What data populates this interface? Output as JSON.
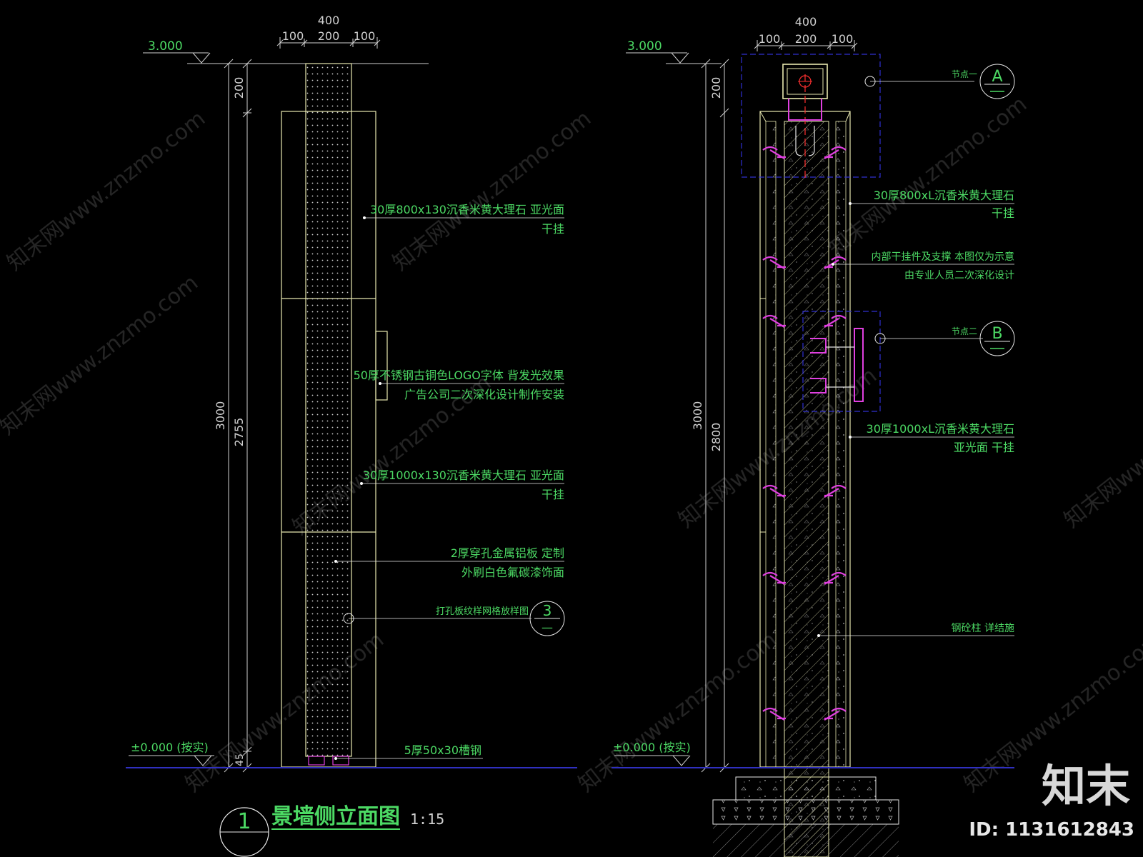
{
  "left": {
    "top_dim_total": "400",
    "top_dim_parts": [
      "100",
      "200",
      "100"
    ],
    "top_level": "3.000",
    "ground_level": "±0.000 (按实)",
    "dim_total_height": "3000",
    "dim_top_segment": "200",
    "dim_mid_segment": "2755",
    "dim_bottom_segment": "45",
    "notes": [
      {
        "line1": "30厚800x130沉香米黄大理石  亚光面",
        "line2": "干挂"
      },
      {
        "line1": "50厚不锈钢古铜色LOGO字体  背发光效果",
        "line2": "广告公司二次深化设计制作安装"
      },
      {
        "line1": "30厚1000x130沉香米黄大理石  亚光面",
        "line2": "干挂"
      },
      {
        "line1": "2厚穿孔金属铝板  定制",
        "line2": "外刷白色氟碳漆饰面"
      },
      {
        "line1": "打孔板纹样网格放样图",
        "line2": ""
      },
      {
        "line1": "5厚50x30槽钢",
        "line2": ""
      }
    ],
    "ref_bubble": {
      "top": "3",
      "bottom": "—"
    }
  },
  "title": {
    "bubble": "1",
    "text": "景墙侧立面图",
    "scale": "1:15"
  },
  "right": {
    "top_dim_total": "400",
    "top_dim_parts": [
      "100",
      "200",
      "100"
    ],
    "top_level": "3.000",
    "ground_level": "±0.000 (按实)",
    "dim_total_height": "3000",
    "dim_top_segment": "200",
    "dim_mid_segment": "2800",
    "node_a": {
      "label": "节点一",
      "letter": "A"
    },
    "node_b": {
      "label": "节点二",
      "letter": "B"
    },
    "notes": [
      {
        "line1": "30厚800xL沉香米黄大理石",
        "line2": "干挂"
      },
      {
        "line1": "内部干挂件及支撑  本图仅为示意",
        "line2": "由专业人员二次深化设计"
      },
      {
        "line1": "30厚1000xL沉香米黄大理石",
        "line2": "亚光面  干挂"
      },
      {
        "line1": "钢砼柱  详结施",
        "line2": ""
      }
    ]
  },
  "watermark": {
    "text": "知末网www.znzmo.com",
    "logo": "知末",
    "id": "ID: 1131612843"
  },
  "colors": {
    "background": "#000000",
    "outline": "#E8E8B0",
    "note_text": "#4CD964",
    "dim_line": "#D0D0D0",
    "accent_magenta": "#E040E0",
    "accent_red": "#FF3030",
    "ground_line": "#3030C0",
    "node_frame": "#3030D0"
  }
}
